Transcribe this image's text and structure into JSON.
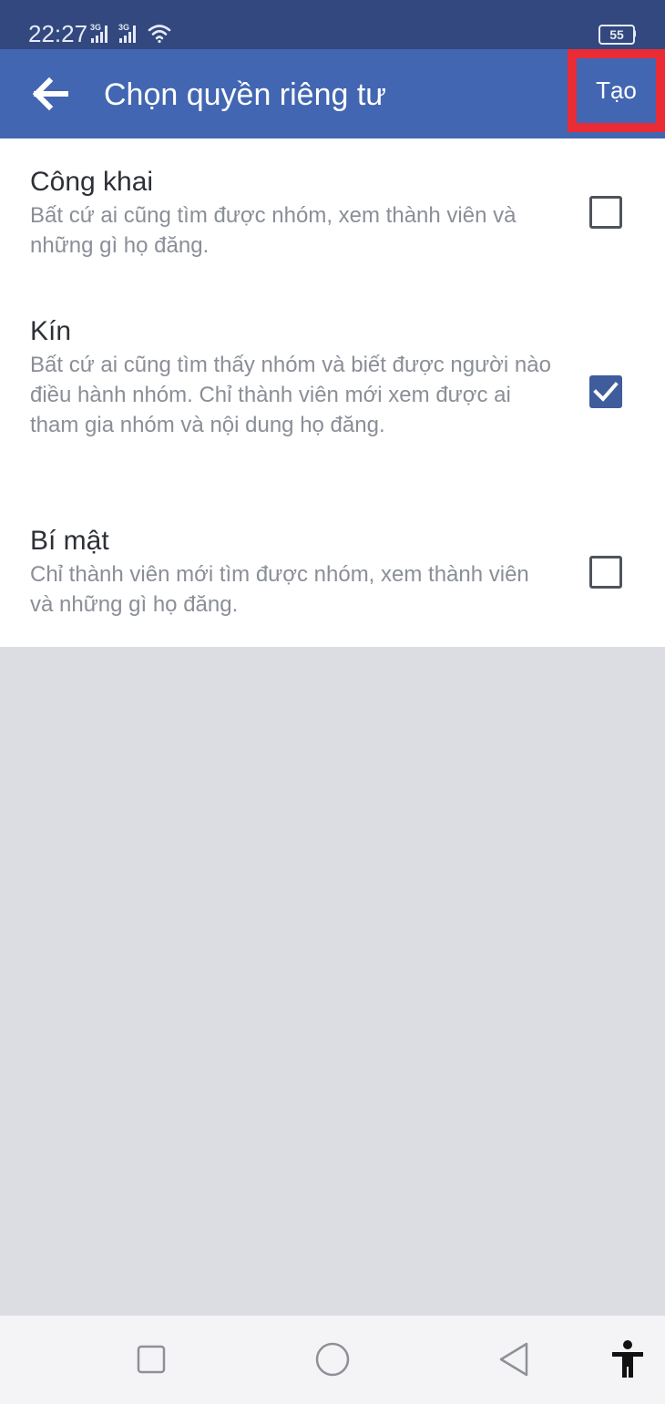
{
  "status_bar": {
    "time": "22:27",
    "network_label_1": "3G",
    "network_label_2": "3G",
    "battery_level": "55",
    "icons": [
      "signal-3g-icon",
      "signal-3g-icon",
      "wifi-icon",
      "battery-icon"
    ]
  },
  "app_bar": {
    "back_icon": "arrow-left-icon",
    "title": "Chọn quyền riêng tư",
    "create_label": "Tạo",
    "highlight_color": "#ea2c36",
    "color": "#4266b2"
  },
  "privacy_options": [
    {
      "title": "Công khai",
      "description": "Bất cứ ai cũng tìm được nhóm, xem thành viên và những gì họ đăng.",
      "checked": false
    },
    {
      "title": "Kín",
      "description": "Bất cứ ai cũng tìm thấy nhóm và biết được người nào điều hành nhóm. Chỉ thành viên mới xem được ai tham gia nhóm và nội dung họ đăng.",
      "checked": true
    },
    {
      "title": "Bí mật",
      "description": "Chỉ thành viên mới tìm được nhóm, xem thành viên và những gì họ đăng.",
      "checked": false
    }
  ],
  "nav_bar": {
    "icons": [
      "recent-apps-icon",
      "home-icon",
      "back-icon",
      "accessibility-icon"
    ]
  }
}
